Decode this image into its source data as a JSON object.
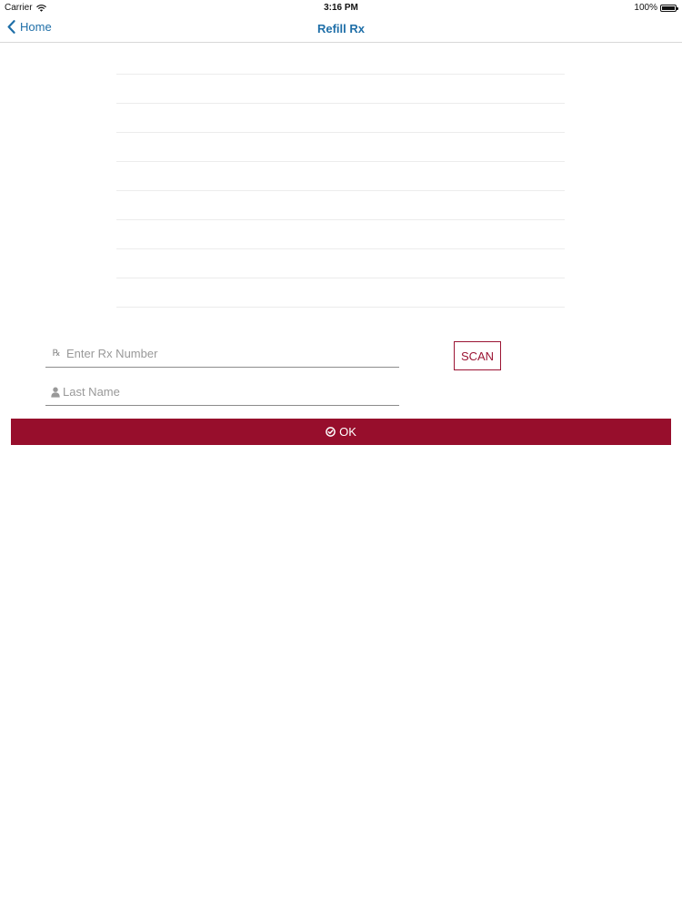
{
  "status_bar": {
    "carrier": "Carrier",
    "time": "3:16 PM",
    "battery_text": "100%",
    "battery_level": 1.0
  },
  "nav": {
    "back_label": "Home",
    "title": "Refill Rx",
    "accent_color": "#1f6fa8"
  },
  "form": {
    "rx_field": {
      "value": "",
      "placeholder": "Enter Rx Number",
      "icon": "rx-icon"
    },
    "last_name_field": {
      "value": "",
      "placeholder": "Last Name",
      "icon": "user-icon"
    },
    "scan_label": "SCAN",
    "ok_label": "OK",
    "ok_icon": "check-circle-icon",
    "brand_color": "#970e2c"
  }
}
